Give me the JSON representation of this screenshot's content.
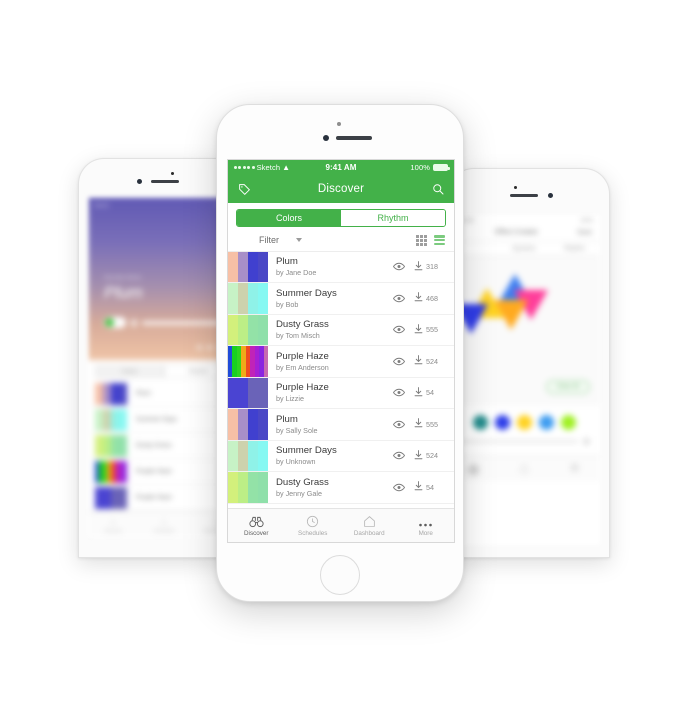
{
  "center_phone": {
    "status_bar": {
      "carrier": "Sketch",
      "time": "9:41 AM",
      "battery": "100%"
    },
    "nav": {
      "title": "Discover",
      "left_icon": "tag-icon",
      "right_icon": "search-icon"
    },
    "segmented": {
      "options": [
        "Colors",
        "Rhythm"
      ],
      "selected": "Colors"
    },
    "filter": {
      "label": "Filter",
      "view_grid": "grid-view-icon",
      "view_list": "list-view-icon",
      "active_view": "list"
    },
    "palettes": [
      {
        "title": "Plum",
        "author": "by Jane Doe",
        "downloads": "318",
        "colors": [
          "#f7c0a6",
          "#a88fc8",
          "#4040cf",
          "#4a47c6"
        ]
      },
      {
        "title": "Summer Days",
        "author": "by Bob",
        "downloads": "468",
        "colors": [
          "#c7f2c6",
          "#cdd2ad",
          "#8ff2e8",
          "#86f8f2"
        ]
      },
      {
        "title": "Dusty Grass",
        "author": "by Tom Misch",
        "downloads": "555",
        "colors": [
          "#d3f07c",
          "#bcee86",
          "#93e2a7",
          "#8fe0aa"
        ]
      },
      {
        "title": "Purple Haze",
        "author": "by Em Anderson",
        "downloads": "524",
        "colors": [
          "#1f4bd8",
          "#18d020",
          "#2fd41f",
          "#f0aa18",
          "#ef4a22",
          "#c023b8",
          "#a61fd4",
          "#8a25e0",
          "#c76ab0"
        ]
      },
      {
        "title": "Purple Haze",
        "author": "by Lizzie",
        "downloads": "54",
        "colors": [
          "#4a44d2",
          "#4a44d2",
          "#6a63b8",
          "#6a63b8"
        ]
      },
      {
        "title": "Plum",
        "author": "by Sally Sole",
        "downloads": "555",
        "colors": [
          "#f7c0a6",
          "#a88fc8",
          "#4040cf",
          "#4a47c6"
        ]
      },
      {
        "title": "Summer Days",
        "author": "by Unknown",
        "downloads": "524",
        "colors": [
          "#c7f2c6",
          "#cdd2ad",
          "#8ff2e8",
          "#86f8f2"
        ]
      },
      {
        "title": "Dusty Grass",
        "author": "by Jenny Gale",
        "downloads": "54",
        "colors": [
          "#d3f07c",
          "#bcee86",
          "#93e2a7",
          "#8fe0aa"
        ]
      }
    ],
    "tabs": [
      {
        "label": "Discover",
        "icon": "binoculars-icon",
        "active": true
      },
      {
        "label": "Schedules",
        "icon": "clock-icon",
        "active": false
      },
      {
        "label": "Dashboard",
        "icon": "home-icon",
        "active": false
      },
      {
        "label": "More",
        "icon": "ellipsis-icon",
        "active": false
      }
    ]
  },
  "left_phone": {
    "status_bar": {
      "carrier": "Sketch",
      "time": "9:41 AM"
    },
    "detail": {
      "subtitle": "Serenity Series",
      "title": "Plum"
    },
    "segmented": {
      "options": [
        "Colors",
        "Rhythm"
      ],
      "selected": "Colors"
    },
    "palettes": [
      {
        "title": "Plum",
        "colors": [
          "#f7c0a6",
          "#a88fc8",
          "#4040cf",
          "#4a47c6"
        ]
      },
      {
        "title": "Summer Days",
        "colors": [
          "#c7f2c6",
          "#cdd2ad",
          "#8ff2e8",
          "#86f8f2"
        ]
      },
      {
        "title": "Dusty Grass",
        "colors": [
          "#d3f07c",
          "#bcee86",
          "#93e2a7",
          "#8fe0aa"
        ]
      },
      {
        "title": "Purple Haze",
        "colors": [
          "#1f4bd8",
          "#18d020",
          "#2fd41f",
          "#f0aa18",
          "#ef4a22",
          "#c023b8",
          "#a61fd4",
          "#8a25e0"
        ]
      },
      {
        "title": "Purple Haze",
        "colors": [
          "#4a44d2",
          "#4a44d2",
          "#6a63b8",
          "#6a63b8"
        ]
      }
    ],
    "tabs": [
      {
        "label": "Discover"
      },
      {
        "label": "Schedules"
      },
      {
        "label": "Dashboard"
      }
    ]
  },
  "right_phone": {
    "status_bar": {
      "time": "9:41 AM",
      "battery": "100%"
    },
    "nav": {
      "title": "Effect Creator",
      "info_icon": "info-icon",
      "save_label": "Save"
    },
    "segmented": {
      "options": [
        "",
        "Dynamic",
        "Rhythm"
      ],
      "selected": "Dynamic"
    },
    "canvas": {
      "clear_all_label": "Clear All",
      "panel_colors": [
        "#3b7ef0",
        "#ff3d9a",
        "#ffaa1f",
        "#ffd21f",
        "#2f3ce8"
      ]
    },
    "color_dots": [
      "#1f8a8a",
      "#2a3be8",
      "#ffd21f",
      "#3b9bf0",
      "#9ef01f"
    ],
    "tabs": [
      {
        "icon": "palette-icon"
      },
      {
        "icon": "home-icon"
      },
      {
        "icon": "sliders-icon"
      }
    ]
  }
}
